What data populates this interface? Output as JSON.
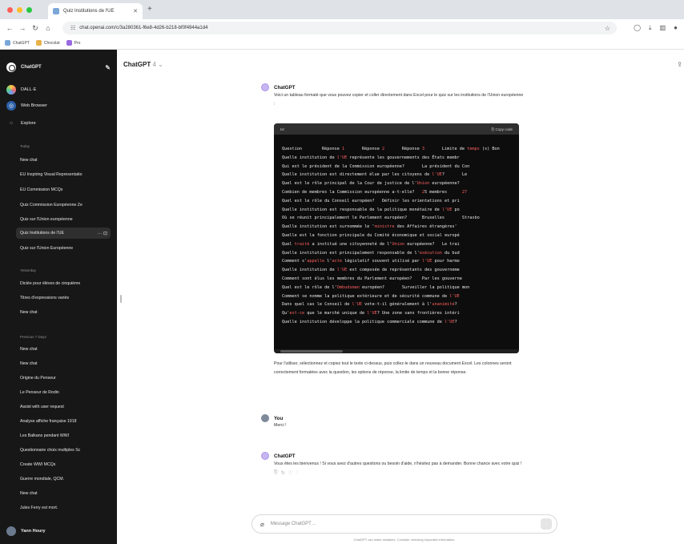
{
  "browser": {
    "tab_title": "Quiz Institutions de l'UE",
    "url": "chat.openai.com/c/3a280361-f6e8-4d26-b218-bf0f4944a1d4",
    "bookmarks": [
      "ChatGPT",
      "Chocolat",
      "Pro"
    ],
    "traffic_colors": [
      "#ff5f57",
      "#febc2e",
      "#28c840"
    ]
  },
  "sidebar": {
    "brand": "ChatGPT",
    "gpts": [
      {
        "label": "DALL·E",
        "icon": "dalle-icon"
      },
      {
        "label": "Web Browser",
        "icon": "web-browser-icon"
      },
      {
        "label": "Explore",
        "icon": "grid-icon"
      }
    ],
    "sections": [
      {
        "heading": "Today",
        "items": [
          {
            "label": "New chat",
            "active": false
          },
          {
            "label": "EU Inspiring Visual Representatio",
            "active": false
          },
          {
            "label": "EU Commission MCQs",
            "active": false
          },
          {
            "label": "Quiz Commission Européenne Ze",
            "active": false
          },
          {
            "label": "Quiz sur l'Union européenne",
            "active": false
          },
          {
            "label": "Quiz Institutions de l'UE",
            "active": true
          },
          {
            "label": "Quiz sur l'Union Européenne",
            "active": false
          }
        ]
      },
      {
        "heading": "Yesterday",
        "items": [
          {
            "label": "Dictée pour élèves de cinquième",
            "active": false
          },
          {
            "label": "Titres d'expressions variés",
            "active": false
          },
          {
            "label": "New chat",
            "active": false
          }
        ]
      },
      {
        "heading": "Previous 7 Days",
        "items": [
          {
            "label": "New chat",
            "active": false
          },
          {
            "label": "New chat",
            "active": false
          },
          {
            "label": "Origine du Penseur",
            "active": false
          },
          {
            "label": "Le Penseur de Rodin",
            "active": false
          },
          {
            "label": "Assist with user request",
            "active": false
          },
          {
            "label": "Analyse affiche française 1918",
            "active": false
          },
          {
            "label": "Les Balkans pendant WWI",
            "active": false
          },
          {
            "label": "Questionnaire choix multiples Sc",
            "active": false
          },
          {
            "label": "Create WWI MCQs",
            "active": false
          },
          {
            "label": "Guerre mondiale, QCM.",
            "active": false
          },
          {
            "label": "New chat",
            "active": false
          },
          {
            "label": "Jules Ferry est mort.",
            "active": false
          }
        ]
      }
    ],
    "user_name": "Yann Houry"
  },
  "main": {
    "model_name": "ChatGPT",
    "model_version": "4",
    "messages": [
      {
        "role": "assistant",
        "author": "ChatGPT",
        "text": "Voici un tableau formaté que vous pouvez copier et coller directement dans Excel pour le quiz sur les institutions de l'Union européenne :"
      },
      {
        "role": "assistant",
        "author": "ChatGPT",
        "text": "Pour l'utiliser, sélectionnez et copiez tout le texte ci-dessus, puis collez-le dans un nouveau document Excel. Les colonnes seront correctement formatées avec la question, les options de réponse, la limite de temps et la bonne réponse."
      },
      {
        "role": "user",
        "author": "You",
        "text": "Merci !"
      },
      {
        "role": "assistant",
        "author": "ChatGPT",
        "text": "Vous êtes les bienvenus ! Si vous avez d'autres questions ou besoin d'aide, n'hésitez pas à demander. Bonne chance avec votre quiz !"
      }
    ],
    "code_block": {
      "lang": "txt",
      "copy_label": "Copy code",
      "lines": [
        "Question\tRéponse 1\tRéponse 2\tRéponse 3\tLimite de temps (s) Bon",
        "Quelle institution de l'UE représente les gouvernements des États membr",
        "Qui est le président de la Commission européenne?\tLa président du Con",
        "Quelle institution est directement élue par les citoyens de l'UE?\tLe",
        "Quel est le rôle principal de la Cour de justice de l'Union européenne?",
        "Combien de membres la Commission européenne a-t-elle?\t25 membres\t27",
        "Quel est le rôle du Conseil européen?\tDéfinir les orientations et pri",
        "Quelle institution est responsable de la politique monétaire de l'UE po",
        "Où se réunit principalement le Parlement européen?\tBruxelles\tStrasbo",
        "Quelle institution est surnommée le 'ministre des Affaires étrangères'",
        "Quelle est la fonction principale du Comité économique et social europé",
        "Quel traité a institué une citoyenneté de l'Union européenne?\tLe trai",
        "Quelle institution est principalement responsable de l'exécution du bud",
        "Comment s'appelle l'acte législatif souvent utilisé par l'UE pour harmo",
        "Quelle institution de l'UE est composée de représentants des gouverneme",
        "Comment sont élus les membres du Parlement européen?\tPar les gouverne",
        "Quel est le rôle de l'Ombudsman européen?\tSurveiller la politique mon",
        "Comment se nomme la politique extérieure et de sécurité commune de l'UE",
        "Dans quel cas le Conseil de l'UE vote-t-il généralement à l'unanimité?",
        "Qu'est-ce que le marché unique de l'UE? Une zone sans frontières intéri",
        "Quelle institution développe la politique commerciale commune de l'UE?"
      ]
    },
    "input_placeholder": "Message ChatGPT…",
    "disclaimer": "ChatGPT can make mistakes. Consider checking important information."
  }
}
